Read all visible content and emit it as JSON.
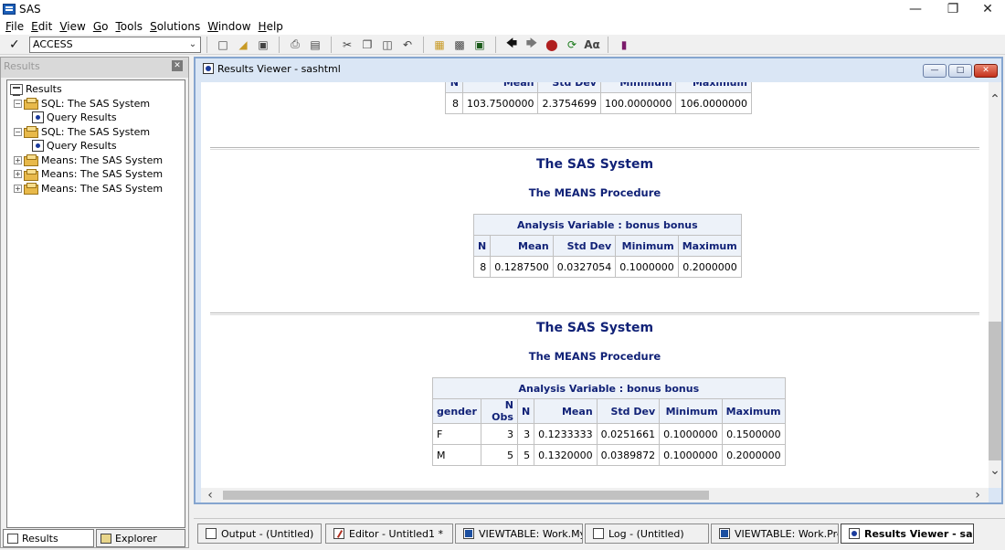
{
  "app": {
    "title": "SAS"
  },
  "menu": [
    "File",
    "Edit",
    "View",
    "Go",
    "Tools",
    "Solutions",
    "Window",
    "Help"
  ],
  "toolbar": {
    "command_value": "ACCESS"
  },
  "results_pane": {
    "title": "Results",
    "tree": [
      {
        "label": "Results",
        "level": 0,
        "icon": "results-icon"
      },
      {
        "label": "SQL:  The SAS System",
        "level": 1,
        "icon": "folder-icon",
        "expander": "−"
      },
      {
        "label": "Query Results",
        "level": 2,
        "icon": "query-icon"
      },
      {
        "label": "SQL:  The SAS System",
        "level": 1,
        "icon": "folder-icon",
        "expander": "−"
      },
      {
        "label": "Query Results",
        "level": 2,
        "icon": "query-icon"
      },
      {
        "label": "Means:  The SAS System",
        "level": 1,
        "icon": "folder-icon",
        "expander": "+"
      },
      {
        "label": "Means:  The SAS System",
        "level": 1,
        "icon": "folder-icon",
        "expander": "+"
      },
      {
        "label": "Means:  The SAS System",
        "level": 1,
        "icon": "folder-icon",
        "expander": "+"
      }
    ],
    "tabs": [
      "Results",
      "Explorer"
    ]
  },
  "viewer": {
    "title": "Results Viewer - sashtml",
    "partial_table": {
      "headers": [
        "N",
        "Mean",
        "Std Dev",
        "Minimum",
        "Maximum"
      ],
      "row": [
        "8",
        "103.7500000",
        "2.3754699",
        "100.0000000",
        "106.0000000"
      ]
    },
    "section1": {
      "title": "The SAS System",
      "subtitle": "The MEANS Procedure",
      "caption": "Analysis Variable : bonus bonus",
      "headers": [
        "N",
        "Mean",
        "Std Dev",
        "Minimum",
        "Maximum"
      ],
      "row": [
        "8",
        "0.1287500",
        "0.0327054",
        "0.1000000",
        "0.2000000"
      ]
    },
    "section2": {
      "title": "The SAS System",
      "subtitle": "The MEANS Procedure",
      "caption": "Analysis Variable : bonus bonus",
      "headers": [
        "gender",
        "N Obs",
        "N",
        "Mean",
        "Std Dev",
        "Minimum",
        "Maximum"
      ],
      "rows": [
        [
          "F",
          "3",
          "3",
          "0.1233333",
          "0.0251661",
          "0.1000000",
          "0.1500000"
        ],
        [
          "M",
          "5",
          "5",
          "0.1320000",
          "0.0389872",
          "0.1000000",
          "0.2000000"
        ]
      ]
    }
  },
  "taskbar": [
    {
      "label": "Output - (Untitled)",
      "icon": "output-icon"
    },
    {
      "label": "Editor - Untitled1 *",
      "icon": "editor-icon"
    },
    {
      "label": "VIEWTABLE: Work.Mym...",
      "icon": "viewtable-icon"
    },
    {
      "label": "Log - (Untitled)",
      "icon": "log-icon"
    },
    {
      "label": "VIEWTABLE: Work.Prest...",
      "icon": "viewtable-icon"
    },
    {
      "label": "Results Viewer - sasht...",
      "icon": "results-viewer-icon",
      "active": true
    }
  ]
}
